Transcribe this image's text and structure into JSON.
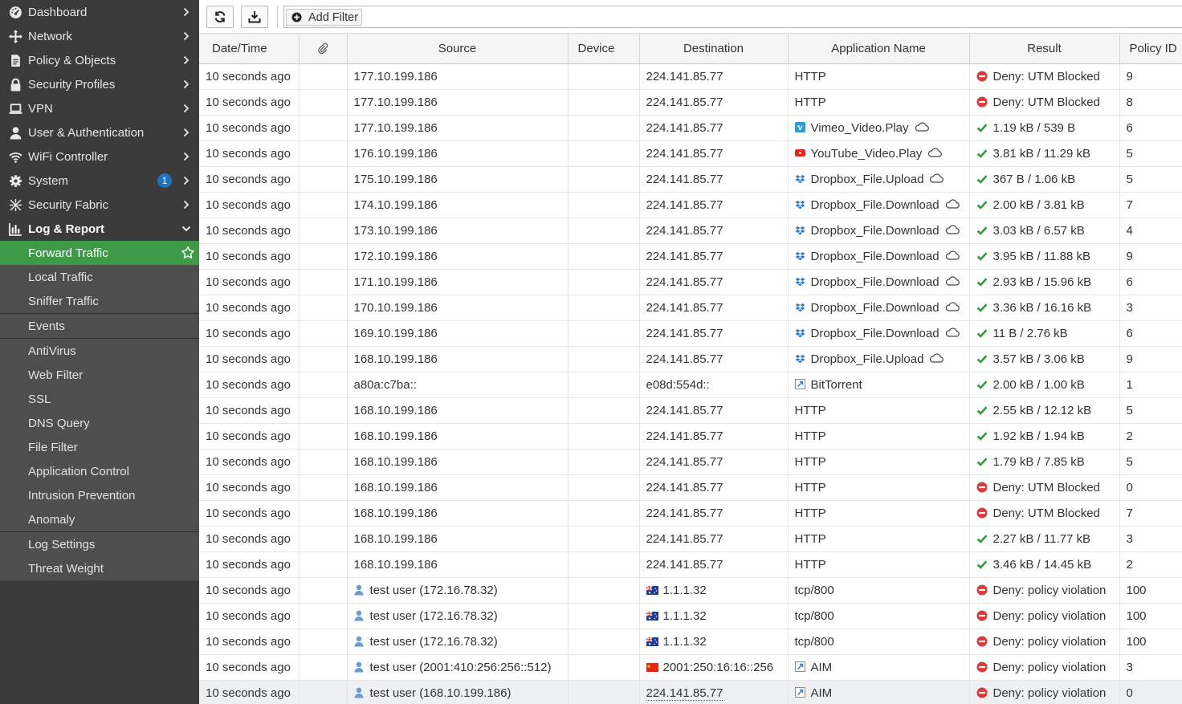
{
  "sidebar": {
    "items": [
      {
        "label": "Dashboard",
        "icon": "dashboard-icon"
      },
      {
        "label": "Network",
        "icon": "network-icon"
      },
      {
        "label": "Policy & Objects",
        "icon": "policy-icon"
      },
      {
        "label": "Security Profiles",
        "icon": "lock-icon"
      },
      {
        "label": "VPN",
        "icon": "laptop-icon"
      },
      {
        "label": "User & Authentication",
        "icon": "user-icon"
      },
      {
        "label": "WiFi Controller",
        "icon": "wifi-icon"
      },
      {
        "label": "System",
        "icon": "gear-icon",
        "badge": "1"
      },
      {
        "label": "Security Fabric",
        "icon": "fabric-icon"
      },
      {
        "label": "Log & Report",
        "icon": "chart-icon"
      }
    ],
    "log_report_items": {
      "group1": [
        "Forward Traffic",
        "Local Traffic",
        "Sniffer Traffic"
      ],
      "group2": [
        "Events"
      ],
      "group3": [
        "AntiVirus",
        "Web Filter",
        "SSL",
        "DNS Query",
        "File Filter",
        "Application Control",
        "Intrusion Prevention",
        "Anomaly"
      ],
      "group4": [
        "Log Settings",
        "Threat Weight"
      ]
    },
    "active_item": "Forward Traffic"
  },
  "toolbar": {
    "add_filter_label": "Add Filter"
  },
  "table": {
    "headers": [
      "Date/Time",
      "",
      "Source",
      "Device",
      "Destination",
      "Application Name",
      "Result",
      "Policy ID"
    ],
    "rows": [
      {
        "time": "10 seconds ago",
        "source": "177.10.199.186",
        "dest": "224.141.85.77",
        "app": "HTTP",
        "result": "Deny: UTM Blocked",
        "status": "deny",
        "policy": "9"
      },
      {
        "time": "10 seconds ago",
        "source": "177.10.199.186",
        "dest": "224.141.85.77",
        "app": "HTTP",
        "result": "Deny: UTM Blocked",
        "status": "deny",
        "policy": "8"
      },
      {
        "time": "10 seconds ago",
        "source": "177.10.199.186",
        "dest": "224.141.85.77",
        "app": "Vimeo_Video.Play",
        "app_icon": "vimeo",
        "cloud": true,
        "result": "1.19 kB / 539 B",
        "status": "ok",
        "policy": "6"
      },
      {
        "time": "10 seconds ago",
        "source": "176.10.199.186",
        "dest": "224.141.85.77",
        "app": "YouTube_Video.Play",
        "app_icon": "youtube",
        "cloud": true,
        "result": "3.81 kB / 11.29 kB",
        "status": "ok",
        "policy": "5"
      },
      {
        "time": "10 seconds ago",
        "source": "175.10.199.186",
        "dest": "224.141.85.77",
        "app": "Dropbox_File.Upload",
        "app_icon": "dropbox",
        "cloud": true,
        "result": "367 B / 1.06 kB",
        "status": "ok",
        "policy": "5"
      },
      {
        "time": "10 seconds ago",
        "source": "174.10.199.186",
        "dest": "224.141.85.77",
        "app": "Dropbox_File.Download",
        "app_icon": "dropbox",
        "cloud": true,
        "result": "2.00 kB / 3.81 kB",
        "status": "ok",
        "policy": "7"
      },
      {
        "time": "10 seconds ago",
        "source": "173.10.199.186",
        "dest": "224.141.85.77",
        "app": "Dropbox_File.Download",
        "app_icon": "dropbox",
        "cloud": true,
        "result": "3.03 kB / 6.57 kB",
        "status": "ok",
        "policy": "4"
      },
      {
        "time": "10 seconds ago",
        "source": "172.10.199.186",
        "dest": "224.141.85.77",
        "app": "Dropbox_File.Download",
        "app_icon": "dropbox",
        "cloud": true,
        "result": "3.95 kB / 11.88 kB",
        "status": "ok",
        "policy": "9"
      },
      {
        "time": "10 seconds ago",
        "source": "171.10.199.186",
        "dest": "224.141.85.77",
        "app": "Dropbox_File.Download",
        "app_icon": "dropbox",
        "cloud": true,
        "result": "2.93 kB / 15.96 kB",
        "status": "ok",
        "policy": "6"
      },
      {
        "time": "10 seconds ago",
        "source": "170.10.199.186",
        "dest": "224.141.85.77",
        "app": "Dropbox_File.Download",
        "app_icon": "dropbox",
        "cloud": true,
        "result": "3.36 kB / 16.16 kB",
        "status": "ok",
        "policy": "3"
      },
      {
        "time": "10 seconds ago",
        "source": "169.10.199.186",
        "dest": "224.141.85.77",
        "app": "Dropbox_File.Download",
        "app_icon": "dropbox",
        "cloud": true,
        "result": "11 B / 2.76 kB",
        "status": "ok",
        "policy": "6"
      },
      {
        "time": "10 seconds ago",
        "source": "168.10.199.186",
        "dest": "224.141.85.77",
        "app": "Dropbox_File.Upload",
        "app_icon": "dropbox",
        "cloud": true,
        "result": "3.57 kB / 3.06 kB",
        "status": "ok",
        "policy": "9"
      },
      {
        "time": "10 seconds ago",
        "source": "a80a:c7ba::",
        "dest": "e08d:554d::",
        "app": "BitTorrent",
        "app_icon": "generic",
        "result": "2.00 kB / 1.00 kB",
        "status": "ok",
        "policy": "1"
      },
      {
        "time": "10 seconds ago",
        "source": "168.10.199.186",
        "dest": "224.141.85.77",
        "app": "HTTP",
        "result": "2.55 kB / 12.12 kB",
        "status": "ok",
        "policy": "5"
      },
      {
        "time": "10 seconds ago",
        "source": "168.10.199.186",
        "dest": "224.141.85.77",
        "app": "HTTP",
        "result": "1.92 kB / 1.94 kB",
        "status": "ok",
        "policy": "2"
      },
      {
        "time": "10 seconds ago",
        "source": "168.10.199.186",
        "dest": "224.141.85.77",
        "app": "HTTP",
        "result": "1.79 kB / 7.85 kB",
        "status": "ok",
        "policy": "5"
      },
      {
        "time": "10 seconds ago",
        "source": "168.10.199.186",
        "dest": "224.141.85.77",
        "app": "HTTP",
        "result": "Deny: UTM Blocked",
        "status": "deny",
        "policy": "0"
      },
      {
        "time": "10 seconds ago",
        "source": "168.10.199.186",
        "dest": "224.141.85.77",
        "app": "HTTP",
        "result": "Deny: UTM Blocked",
        "status": "deny",
        "policy": "7"
      },
      {
        "time": "10 seconds ago",
        "source": "168.10.199.186",
        "dest": "224.141.85.77",
        "app": "HTTP",
        "result": "2.27 kB / 11.77 kB",
        "status": "ok",
        "policy": "3"
      },
      {
        "time": "10 seconds ago",
        "source": "168.10.199.186",
        "dest": "224.141.85.77",
        "app": "HTTP",
        "result": "3.46 kB / 14.45 kB",
        "status": "ok",
        "policy": "2"
      },
      {
        "time": "10 seconds ago",
        "source": "test user (172.16.78.32)",
        "source_user": true,
        "dest": "1.1.1.32",
        "dest_flag": "au",
        "app": "tcp/800",
        "result": "Deny: policy violation",
        "status": "deny",
        "policy": "100"
      },
      {
        "time": "10 seconds ago",
        "source": "test user (172.16.78.32)",
        "source_user": true,
        "dest": "1.1.1.32",
        "dest_flag": "au",
        "app": "tcp/800",
        "result": "Deny: policy violation",
        "status": "deny",
        "policy": "100"
      },
      {
        "time": "10 seconds ago",
        "source": "test user (172.16.78.32)",
        "source_user": true,
        "dest": "1.1.1.32",
        "dest_flag": "au",
        "app": "tcp/800",
        "result": "Deny: policy violation",
        "status": "deny",
        "policy": "100"
      },
      {
        "time": "10 seconds ago",
        "source": "test user (2001:410:256:256::512)",
        "source_user": true,
        "dest": "2001:250:16:16::256",
        "dest_flag": "cn",
        "app": "AIM",
        "app_icon": "generic",
        "result": "Deny: policy violation",
        "status": "deny",
        "policy": "3"
      },
      {
        "time": "10 seconds ago",
        "source": "test user (168.10.199.186)",
        "source_user": true,
        "dest": "224.141.85.77",
        "dest_dotted": true,
        "app": "AIM",
        "app_icon": "generic",
        "result": "Deny: policy violation",
        "status": "deny",
        "policy": "0",
        "selected": true
      }
    ]
  },
  "colors": {
    "sidebar_bg": "#3b3b3b",
    "submenu_bg": "#4e4e4e",
    "active_green": "#3d9a46",
    "badge_blue": "#1e73be",
    "ok_green": "#3a9a3f",
    "deny_red": "#d93a3a"
  }
}
